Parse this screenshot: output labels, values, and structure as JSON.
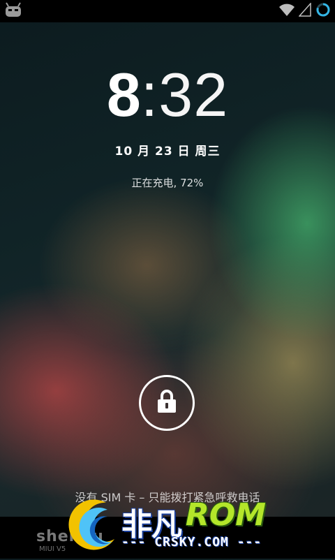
{
  "status_bar": {
    "left_icon": "cyanogen-android-icon",
    "right_icons": [
      "wifi-icon",
      "signal-icon",
      "battery-charging-icon"
    ]
  },
  "clock": {
    "hour": "8",
    "minute": ":32"
  },
  "date": "10 月 23 日 周三",
  "charging_status": "正在充电, 72%",
  "unlock": {
    "icon": "lock-icon"
  },
  "sim_message": "没有 SIM 卡 – 只能拨打紧急呼救电话",
  "watermark": {
    "shendu_text": "shendu",
    "shendu_sub": "MIUI V5",
    "brand_cn": "非凡",
    "brand_rom": "ROM",
    "site": "--- CRSKY.COM ---"
  },
  "colors": {
    "statusbar_bg": "#000000",
    "accent_blue": "#33b5e5",
    "rom_green": "#b4e62a"
  }
}
